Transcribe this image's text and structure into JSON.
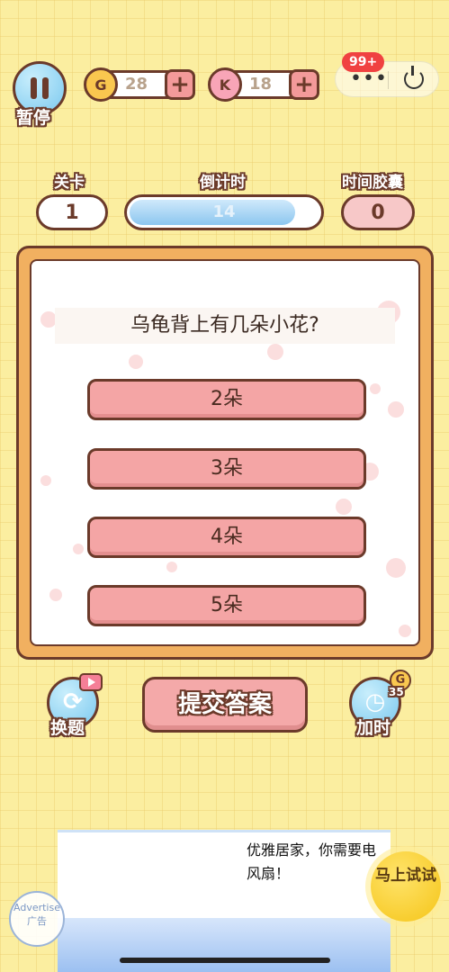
{
  "header": {
    "pause_label": "暂停",
    "coins": {
      "icon": "coin-icon",
      "glyph": "G",
      "value": "28"
    },
    "tokens": {
      "icon": "token-icon",
      "glyph": "K",
      "value": "18"
    },
    "notification_badge": "99+",
    "capsule_menu_glyph": "•••"
  },
  "stats": {
    "level_label": "关卡",
    "level_value": "1",
    "countdown_label": "倒计时",
    "countdown_value": "14",
    "countdown_progress": 0.88,
    "capsule_label": "时间胶囊",
    "capsule_value": "0"
  },
  "quiz": {
    "question": "乌龟背上有几朵小花?",
    "options": [
      "2朵",
      "3朵",
      "4朵",
      "5朵"
    ]
  },
  "controls": {
    "change_label": "换题",
    "submit_label": "提交答案",
    "add_time_label": "加时",
    "add_time_cost": "35",
    "add_time_coin_glyph": "G"
  },
  "ad": {
    "text": "优雅居家，你需要电风扇！",
    "cta": "马上试试",
    "stamp_text": "Advertise 广告"
  },
  "colors": {
    "background": "#fbeea0",
    "outline": "#6b3a2a",
    "option_fill": "#f4a5a5",
    "accent_blue": "#7cc9ef"
  }
}
